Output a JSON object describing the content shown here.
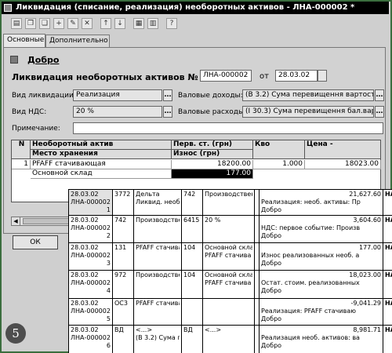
{
  "window": {
    "title": "Ликвидация (списание, реализация) необоротных активов - ЛНА-000002 *"
  },
  "toolbar": {
    "icons": [
      "document-icon",
      "copy-icon",
      "copy-icon",
      "add-icon",
      "edit-icon",
      "delete-icon",
      "up-icon",
      "down-icon",
      "table-icon",
      "table-icon",
      "help-cursor-icon"
    ]
  },
  "tabs": [
    "Основные",
    "Дополнительно"
  ],
  "form": {
    "status_label": "Добро",
    "doc_label": "Ликвидация необоротных активов №",
    "doc_number": "ЛНА-000002",
    "date_label": "от",
    "date": "28.03.02",
    "liq_type_label": "Вид ликвидации:",
    "liq_type": "Реализация",
    "vat_label": "Вид НДС:",
    "vat": "20 %",
    "gross_income_label": "Валовые доходы:",
    "gross_income": "(В 3.2) Сума перевищення вартості",
    "gross_expense_label": "Валовые расходы:",
    "gross_expense": "(І 30.3) Сума перевищення бал.варто",
    "note_label": "Примечание:",
    "note": "",
    "ok_label": "ОК"
  },
  "grid": {
    "headers": {
      "n": "N",
      "asset": "Необоротный актив",
      "location": "Место хранения",
      "initial_cost": "Перв. ст. (грн)",
      "depreciation": "Износ (грн)",
      "qty": "Кво",
      "price": "Цена -"
    },
    "rows": [
      {
        "n": "1",
        "asset": "PFAFF стачивающая",
        "location": "Основной склад",
        "initial_cost": "18200.00",
        "depreciation": "177.00",
        "qty": "1.000",
        "price": "18023.00"
      }
    ]
  },
  "journal": {
    "rows": [
      {
        "date": "28.03.02",
        "doc": "ЛНА-000002",
        "no": "1",
        "dt": "3772",
        "dt_a1": "Дельта",
        "dt_a2": "Ликвид. необ.",
        "kt": "742",
        "kt_a1": "Производствен",
        "kt_a2": "",
        "amount": "21,627.60",
        "desc": "Реализация: необ. активы: Пр",
        "status": "Добро",
        "flag": "НА"
      },
      {
        "date": "28.03.02",
        "doc": "ЛНА-000002",
        "no": "2",
        "dt": "742",
        "dt_a1": "Производствен",
        "dt_a2": "",
        "kt": "6415",
        "kt_a1": "20 %",
        "kt_a2": "",
        "amount": "3,604.60",
        "desc": "НДС: первое событие: Произв",
        "status": "Добро",
        "flag": "НА"
      },
      {
        "date": "28.03.02",
        "doc": "ЛНА-000002",
        "no": "3",
        "dt": "131",
        "dt_a1": "PFAFF стачива",
        "dt_a2": "",
        "kt": "104",
        "kt_a1": "Основной скла",
        "kt_a2": "PFAFF стачива",
        "amount": "177.00",
        "desc": "Износ реализованных необ. а",
        "status": "Добро",
        "flag": "НА"
      },
      {
        "date": "28.03.02",
        "doc": "ЛНА-000002",
        "no": "4",
        "dt": "972",
        "dt_a1": "Производствен",
        "dt_a2": "",
        "kt": "104",
        "kt_a1": "Основной скла",
        "kt_a2": "PFAFF стачива",
        "amount": "18,023.00",
        "desc": "Остат. стоим. реализованных",
        "status": "Добро",
        "flag": "НА"
      },
      {
        "date": "28.03.02",
        "doc": "ЛНА-000002",
        "no": "5",
        "dt": "ОС3",
        "dt_a1": "PFAFF стачива",
        "dt_a2": "",
        "kt": "",
        "kt_a1": "",
        "kt_a2": "",
        "amount": "-9,041.29",
        "desc": "Реализация: PFAFF стачиваю",
        "status": "Добро",
        "flag": "НА"
      },
      {
        "date": "28.03.02",
        "doc": "ЛНА-000002",
        "no": "6",
        "dt": "ВД",
        "dt_a1": "<...>",
        "dt_a2": "(В 3.2) Сума пе",
        "kt": "ВД",
        "kt_a1": "<...>",
        "kt_a2": "",
        "amount": "8,981.71",
        "desc": "Реализация необ. активов: ва",
        "status": "Добро",
        "flag": "НА"
      }
    ]
  },
  "page_badge": "5",
  "colors": {
    "frame": "#3b6e3e",
    "titlebar": "#000000",
    "window_bg": "#cfcfcf",
    "selected_cell": "#000000"
  }
}
